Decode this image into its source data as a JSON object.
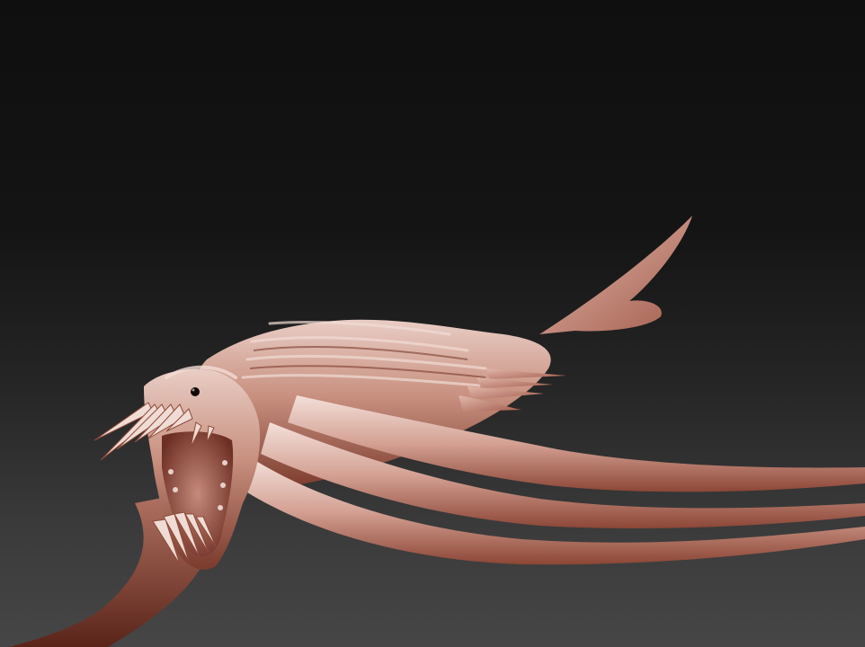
{
  "scene": {
    "subject": "sculpted-sea-creature",
    "material_color": "#c08474",
    "highlight_color": "#f2dcd6",
    "shadow_color": "#6a3024"
  }
}
